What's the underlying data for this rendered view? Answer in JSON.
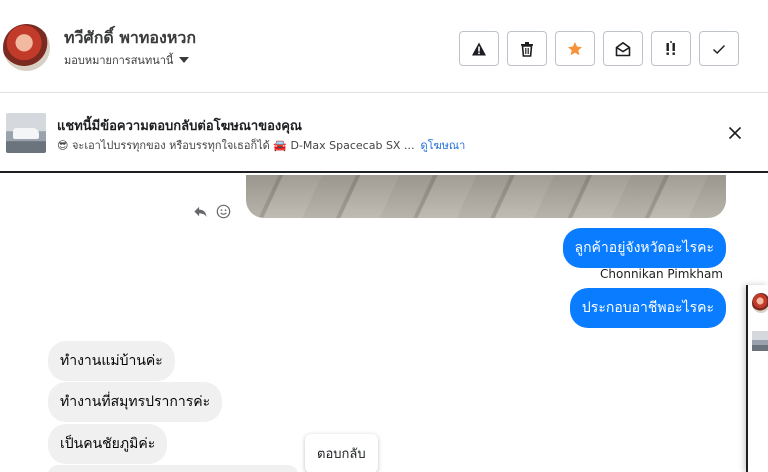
{
  "header": {
    "contact_name": "ทวีศักดิ์ พาทองหวก",
    "assign_label": "มอบหมายการสนทนานี้",
    "actions": [
      {
        "name": "report-spam",
        "icon": "warning-icon"
      },
      {
        "name": "delete",
        "icon": "trash-icon"
      },
      {
        "name": "star",
        "icon": "star-icon"
      },
      {
        "name": "mark-unread",
        "icon": "envelope-open-icon"
      },
      {
        "name": "follow-up",
        "icon": "follow-up-icon"
      },
      {
        "name": "mark-done",
        "icon": "check-icon"
      }
    ]
  },
  "ad_banner": {
    "title": "แชทนี้มีข้อความตอบกลับต่อโฆษณาของคุณ",
    "subtitle": "😎 จะเอาไปบรรทุกของ หรือบรรทุกใจเธอก็ได้ 🚘 D-Max Spacecab SX ...",
    "link_label": "ดูโฆษณา"
  },
  "messages": {
    "outgoing": [
      "ลูกค้าอยู่จังหวัดอะไรคะ",
      "ประกอบอาชีพอะไรคะ"
    ],
    "sender_name": "Chonnikan Pimkham",
    "incoming": [
      "ทำงานแม่บ้านค่ะ",
      "ทำงานที่สมุทรปราการค่ะ",
      "เป็นคนชัยภูมิค่ะ"
    ]
  },
  "tooltip": {
    "reply_label": "ตอบกลับ"
  },
  "colors": {
    "outgoing_bubble": "#0a7cff",
    "incoming_bubble": "#f0f0f0",
    "star_accent": "#f7923b",
    "link": "#216fdb"
  }
}
